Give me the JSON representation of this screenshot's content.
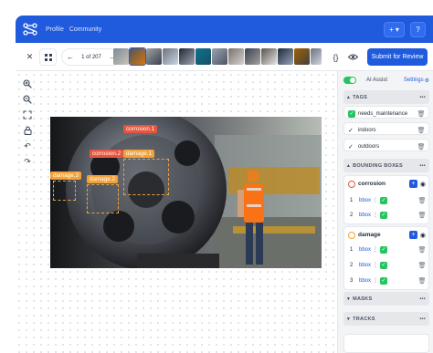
{
  "header": {
    "nav": [
      "Profile",
      "Community"
    ],
    "add_button": "+ ▾",
    "help_button": "?"
  },
  "toolbar": {
    "pager_text": "1 of 207",
    "submit_label": "Submit for Review",
    "code_icon_label": "{}"
  },
  "panel": {
    "ai_assist_label": "AI Assist",
    "settings_label": "Settings",
    "tags_title": "TAGS",
    "tags": [
      {
        "label": "needs_maintenance",
        "checked": true
      },
      {
        "label": "indoors",
        "checked": true
      },
      {
        "label": "outdoors",
        "checked": true
      }
    ],
    "bboxes_title": "BOUNDING BOXES",
    "classes": [
      {
        "name": "corrosion",
        "items": [
          {
            "index": "1",
            "label": "bbox"
          },
          {
            "index": "2",
            "label": "bbox"
          }
        ]
      },
      {
        "name": "damage",
        "items": [
          {
            "index": "1",
            "label": "bbox"
          },
          {
            "index": "2",
            "label": "bbox"
          },
          {
            "index": "3",
            "label": "bbox"
          }
        ]
      }
    ],
    "masks_title": "MASKS",
    "tracks_title": "TRACKS"
  },
  "annotations": {
    "labels": [
      "corrosion.1",
      "corrosion.2",
      "damage.1",
      "damage.3",
      "damage.2"
    ]
  },
  "colors": {
    "brand": "#1f5bdc",
    "corrosion": "#e8543d",
    "damage": "#f2a23a",
    "check": "#22c55e"
  }
}
